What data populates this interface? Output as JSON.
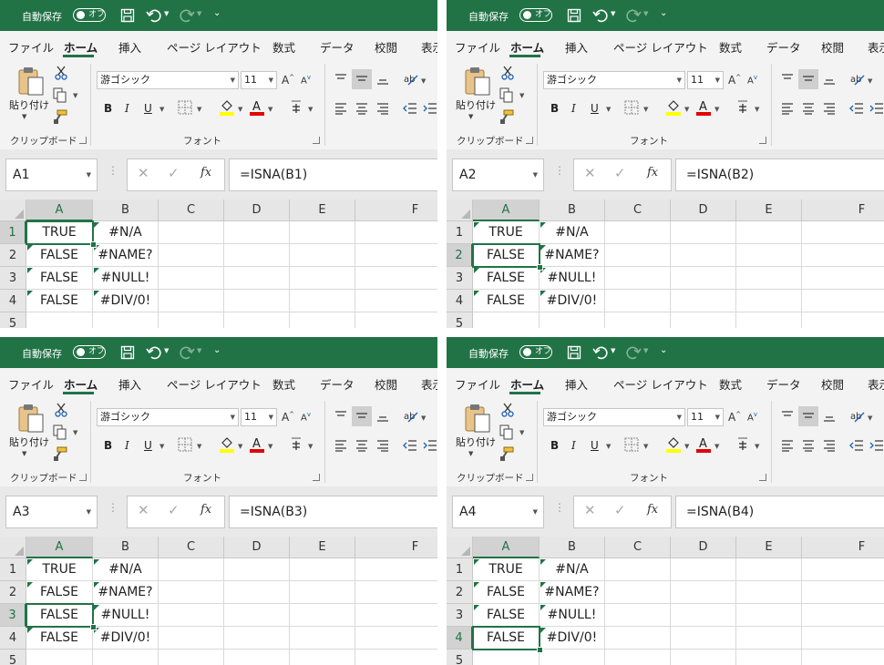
{
  "app": {
    "autosave_label": "自動保存",
    "autosave_state": "オフ",
    "qat_more": "⌄",
    "accent": "#217346"
  },
  "tabs": [
    "ファイル",
    "ホーム",
    "挿入",
    "ページ レイアウト",
    "数式",
    "データ",
    "校閲",
    "表示"
  ],
  "ribbon": {
    "clipboard": {
      "paste_label": "貼り付け",
      "group_label": "クリップボード"
    },
    "font": {
      "font_name": "游ゴシック",
      "font_size": "11",
      "group_label": "フォント",
      "bold": "B",
      "italic": "I",
      "underline": "U"
    }
  },
  "grid": {
    "columns": [
      "A",
      "B",
      "C",
      "D",
      "E",
      "F"
    ],
    "rows": [
      "1",
      "2",
      "3",
      "4",
      "5"
    ],
    "col_a": [
      "TRUE",
      "FALSE",
      "FALSE",
      "FALSE"
    ],
    "col_b": [
      "#N/A",
      "#NAME?",
      "#NULL!",
      "#DIV/0!"
    ]
  },
  "panels": [
    {
      "name_box": "A1",
      "formula": "=ISNA(B1)"
    },
    {
      "name_box": "A2",
      "formula": "=ISNA(B2)"
    },
    {
      "name_box": "A3",
      "formula": "=ISNA(B3)"
    },
    {
      "name_box": "A4",
      "formula": "=ISNA(B4)"
    }
  ]
}
